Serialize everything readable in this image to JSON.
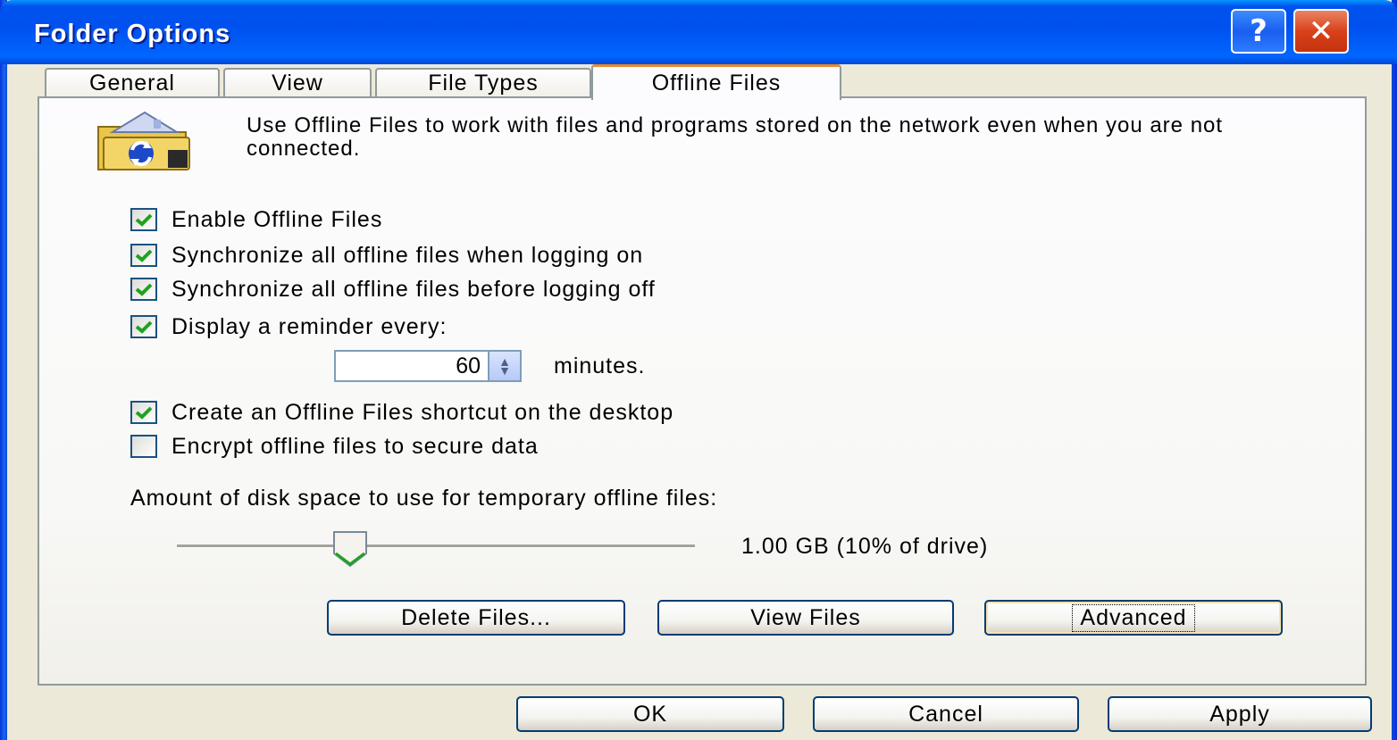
{
  "window": {
    "title": "Folder Options",
    "help_glyph": "?",
    "close_glyph": "✕"
  },
  "tabs": [
    {
      "label": "General",
      "active": false
    },
    {
      "label": "View",
      "active": false
    },
    {
      "label": "File Types",
      "active": false
    },
    {
      "label": "Offline Files",
      "active": true
    }
  ],
  "intro_text": "Use Offline Files to work with files and programs stored on the network even when you are not connected.",
  "options": [
    {
      "label": "Enable Offline Files",
      "checked": true
    },
    {
      "label": "Synchronize all offline files when logging on",
      "checked": true
    },
    {
      "label": "Synchronize all offline files before logging off",
      "checked": true
    },
    {
      "label": "Display a reminder every:",
      "checked": true
    },
    {
      "label": "Create an Offline Files shortcut on the desktop",
      "checked": true
    },
    {
      "label": "Encrypt offline files to secure data",
      "checked": false
    }
  ],
  "reminder": {
    "value": "60",
    "unit": "minutes."
  },
  "disk_space": {
    "label": "Amount of disk space to use for temporary offline files:",
    "value_text": "1.00 GB (10% of drive)",
    "slider_fraction": 0.33
  },
  "panel_buttons": {
    "delete": "Delete Files...",
    "view": "View Files",
    "advanced": "Advanced"
  },
  "dialog_buttons": {
    "ok": "OK",
    "cancel": "Cancel",
    "apply": "Apply"
  },
  "colors": {
    "titlebar": "#0054e3",
    "face": "#ece9d8",
    "check": "#21a121",
    "active_tab_accent": "#e68b2c"
  }
}
